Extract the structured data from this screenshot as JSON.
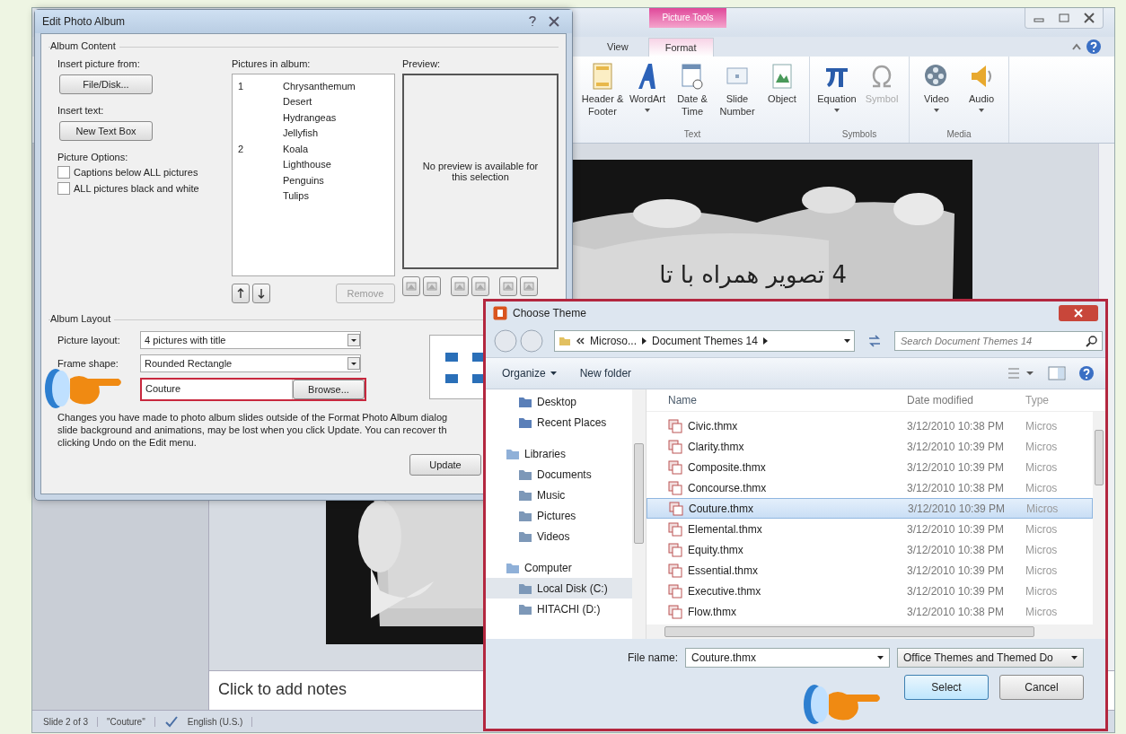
{
  "powerpoint": {
    "contextual_tab": "Picture Tools",
    "ribbon_tabs": [
      {
        "label": "View",
        "selected": false
      },
      {
        "label": "Format",
        "selected": true
      }
    ],
    "ribbon_groups": [
      {
        "label": "Text",
        "commands": [
          {
            "label": "Header & Footer",
            "disabled": false,
            "menu": false
          },
          {
            "label": "WordArt",
            "disabled": false,
            "menu": true
          },
          {
            "label": "Date & Time",
            "disabled": false,
            "menu": false
          },
          {
            "label": "Slide Number",
            "disabled": false,
            "menu": false
          },
          {
            "label": "Object",
            "disabled": false,
            "menu": false
          }
        ]
      },
      {
        "label": "Symbols",
        "commands": [
          {
            "label": "Equation",
            "disabled": false,
            "menu": true
          },
          {
            "label": "Symbol",
            "disabled": true,
            "menu": false
          }
        ]
      },
      {
        "label": "Media",
        "commands": [
          {
            "label": "Video",
            "disabled": false,
            "menu": true
          },
          {
            "label": "Audio",
            "disabled": false,
            "menu": true
          }
        ]
      }
    ],
    "slide_text": "4 تصویر همراه با تا",
    "notes_placeholder": "Click to add notes",
    "status_bar": [
      "Slide 2 of 3",
      "\"Couture\"",
      "English (U.S.)"
    ]
  },
  "edit_photo_album": {
    "title": "Edit Photo Album",
    "album_content": {
      "legend": "Album Content",
      "insert_picture_label": "Insert picture from:",
      "file_disk_button": "File/Disk...",
      "insert_text_label": "Insert text:",
      "new_text_box_button": "New Text Box",
      "picture_options_label": "Picture Options:",
      "options": [
        {
          "label": "Captions below ALL pictures",
          "checked": false
        },
        {
          "label": "ALL pictures black and white",
          "checked": false
        }
      ],
      "pictures_label": "Pictures in album:",
      "pictures": [
        {
          "number": "1",
          "name": "Chrysanthemum",
          "selected": false
        },
        {
          "name": "Desert",
          "selected": false
        },
        {
          "name": "Hydrangeas",
          "selected": false
        },
        {
          "name": "Jellyfish",
          "selected": false
        },
        {
          "number": "2",
          "name": "Koala",
          "selected": false
        },
        {
          "name": "Lighthouse",
          "selected": false
        },
        {
          "name": "Penguins",
          "selected": false
        },
        {
          "name": "Tulips",
          "selected": false
        }
      ],
      "remove_button": "Remove",
      "preview_label": "Preview:",
      "preview_message": "No preview is available for this selection"
    },
    "album_layout": {
      "legend": "Album Layout",
      "picture_layout_label": "Picture layout:",
      "picture_layout": "4 pictures with title",
      "frame_shape_label": "Frame shape:",
      "frame_shape": "Rounded Rectangle",
      "theme": "Couture",
      "browse_button": "Browse...",
      "notice_lines": [
        "Changes you have made to photo album slides outside of the Format Photo Album dialog",
        "slide background and animations, may be lost when you click Update. You can recover th",
        "clicking Undo on the Edit menu."
      ]
    },
    "update_button": "Update"
  },
  "choose_theme": {
    "title": "Choose Theme",
    "breadcrumb": [
      "Microso...",
      "Document Themes 14"
    ],
    "search_placeholder": "Search Document Themes 14",
    "toolbar": [
      "Organize",
      "New folder"
    ],
    "nav": [
      {
        "label": "Desktop",
        "selected": false
      },
      {
        "label": "Recent Places",
        "selected": false
      },
      {
        "label": "Libraries",
        "selected": false,
        "children": [
          {
            "label": "Documents",
            "selected": false
          },
          {
            "label": "Music",
            "selected": false
          },
          {
            "label": "Pictures",
            "selected": false
          },
          {
            "label": "Videos",
            "selected": false
          }
        ]
      },
      {
        "label": "Computer",
        "selected": false,
        "children": [
          {
            "label": "Local Disk (C:)",
            "selected": true
          },
          {
            "label": "HITACHI (D:)",
            "selected": false
          }
        ]
      }
    ],
    "columns": [
      "Name",
      "Date modified",
      "Type"
    ],
    "files": [
      {
        "name": "Civic.thmx",
        "date": "3/12/2010 10:38 PM",
        "type": "Micros",
        "selected": false
      },
      {
        "name": "Clarity.thmx",
        "date": "3/12/2010 10:39 PM",
        "type": "Micros",
        "selected": false
      },
      {
        "name": "Composite.thmx",
        "date": "3/12/2010 10:39 PM",
        "type": "Micros",
        "selected": false
      },
      {
        "name": "Concourse.thmx",
        "date": "3/12/2010 10:38 PM",
        "type": "Micros",
        "selected": false
      },
      {
        "name": "Couture.thmx",
        "date": "3/12/2010 10:39 PM",
        "type": "Micros",
        "selected": true
      },
      {
        "name": "Elemental.thmx",
        "date": "3/12/2010 10:39 PM",
        "type": "Micros",
        "selected": false
      },
      {
        "name": "Equity.thmx",
        "date": "3/12/2010 10:38 PM",
        "type": "Micros",
        "selected": false
      },
      {
        "name": "Essential.thmx",
        "date": "3/12/2010 10:39 PM",
        "type": "Micros",
        "selected": false
      },
      {
        "name": "Executive.thmx",
        "date": "3/12/2010 10:39 PM",
        "type": "Micros",
        "selected": false
      },
      {
        "name": "Flow.thmx",
        "date": "3/12/2010 10:38 PM",
        "type": "Micros",
        "selected": false
      }
    ],
    "file_name_label": "File name:",
    "file_name": "Couture.thmx",
    "file_type": "Office Themes and Themed Do",
    "buttons": [
      "Select",
      "Cancel"
    ]
  }
}
